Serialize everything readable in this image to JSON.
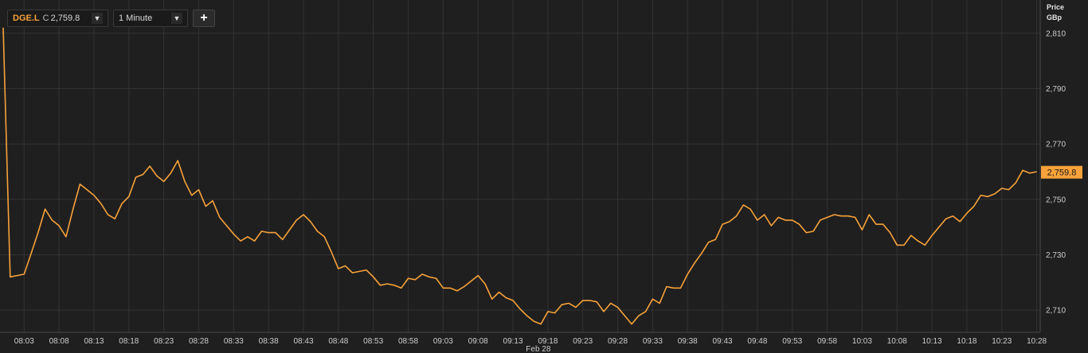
{
  "toolbar": {
    "symbol": "DGE.L",
    "close_label": "C",
    "close_value": "2,759.8",
    "interval": "1 Minute",
    "add_label": "+"
  },
  "colors": {
    "background": "#1f1f1f",
    "line": "#f7a23a",
    "grid": "#333333",
    "text": "#cccccc"
  },
  "chart_data": {
    "type": "line",
    "xlabel": "",
    "ylabel_line1": "Price",
    "ylabel_line2": "GBp",
    "date_label": "Feb 28",
    "ylim": [
      2702,
      2822
    ],
    "yticks": [
      2710,
      2730,
      2750,
      2770,
      2790,
      2810
    ],
    "ytick_labels": [
      "2,710",
      "2,730",
      "2,750",
      "2,770",
      "2,790",
      "2,810"
    ],
    "xticks": [
      "08:03",
      "08:08",
      "08:13",
      "08:18",
      "08:23",
      "08:28",
      "08:33",
      "08:38",
      "08:43",
      "08:48",
      "08:53",
      "08:58",
      "09:03",
      "09:08",
      "09:13",
      "09:18",
      "09:23",
      "09:28",
      "09:33",
      "09:38",
      "09:43",
      "09:48",
      "09:53",
      "09:58",
      "10:03",
      "10:08",
      "10:13",
      "10:18",
      "10:23",
      "10:28"
    ],
    "last_value": 2759.8,
    "last_label": "2,759.8",
    "series": [
      {
        "x_start": "08:00",
        "x_step_minutes": 1,
        "values": [
          2812,
          2722,
          2722.5,
          2723,
          2730.5,
          2738,
          2746.5,
          2742.5,
          2740.5,
          2736.5,
          2746.5,
          2755.5,
          2753.5,
          2751.5,
          2748.5,
          2744.5,
          2743,
          2748.5,
          2751,
          2758,
          2759,
          2762,
          2758.5,
          2756.5,
          2759.5,
          2764,
          2756.5,
          2751.5,
          2753.5,
          2747.5,
          2749.5,
          2743.5,
          2740.5,
          2737.5,
          2735,
          2736.5,
          2735,
          2738.5,
          2738,
          2738,
          2735.5,
          2739,
          2742.5,
          2744.5,
          2742,
          2738.5,
          2736.5,
          2731,
          2725,
          2726,
          2723.5,
          2724,
          2724.5,
          2722,
          2719,
          2719.5,
          2719,
          2718,
          2721.5,
          2721,
          2723,
          2722,
          2721.5,
          2718,
          2718,
          2717,
          2718.5,
          2720.5,
          2722.5,
          2719.5,
          2714,
          2716.5,
          2714.5,
          2713.5,
          2710.5,
          2708,
          2706,
          2705,
          2709.5,
          2709,
          2712,
          2712.5,
          2711,
          2713.5,
          2713.5,
          2713,
          2709.5,
          2712.5,
          2711,
          2708,
          2705,
          2708,
          2709.5,
          2714,
          2712.5,
          2718.5,
          2718,
          2718,
          2723,
          2727,
          2730.5,
          2734.5,
          2735.5,
          2741,
          2742,
          2744,
          2748,
          2746.5,
          2742.5,
          2744.5,
          2740.5,
          2743.5,
          2742.5,
          2742.5,
          2741,
          2738,
          2738.5,
          2742.5,
          2743.5,
          2744.5,
          2744,
          2744,
          2743.5,
          2739,
          2744.5,
          2741,
          2741,
          2738,
          2733.5,
          2733.5,
          2737,
          2735,
          2733.5,
          2737,
          2740,
          2743,
          2744,
          2742,
          2745,
          2747.5,
          2751.5,
          2751,
          2752,
          2754,
          2753.5,
          2756,
          2760.5,
          2759.5,
          2760
        ]
      }
    ]
  }
}
